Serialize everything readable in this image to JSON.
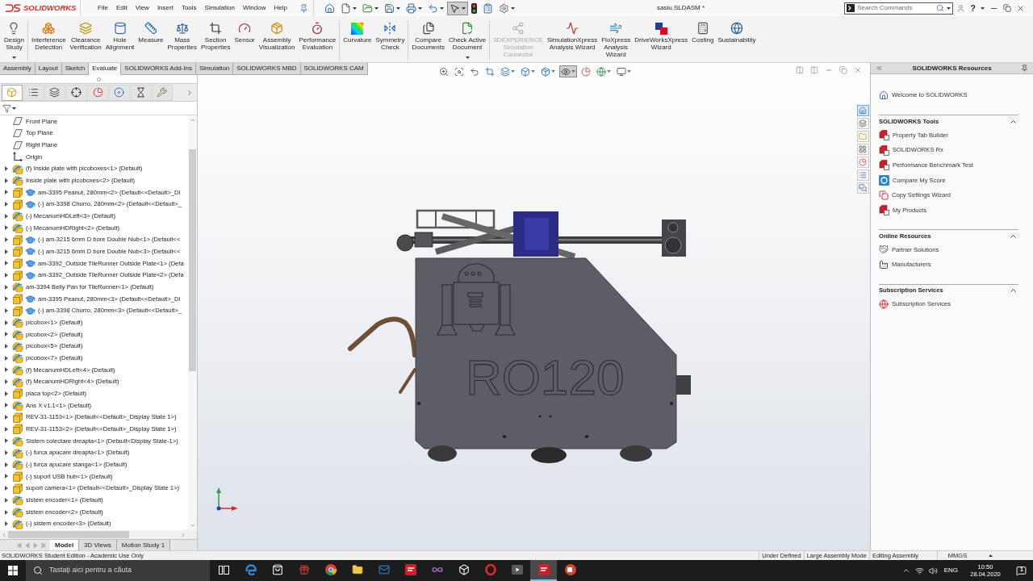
{
  "app": {
    "logo_text": "SOLIDWORKS",
    "title": "sasiu.SLDASM *",
    "search_placeholder": "Search Commands",
    "help": "?"
  },
  "menu": [
    "File",
    "Edit",
    "View",
    "Insert",
    "Tools",
    "Simulation",
    "Window",
    "Help"
  ],
  "quick_access": [
    {
      "kind": "home",
      "dropdown": false,
      "pressed": false
    },
    {
      "kind": "new",
      "dropdown": true,
      "pressed": false
    },
    {
      "kind": "open",
      "dropdown": true,
      "pressed": false
    },
    {
      "kind": "save",
      "dropdown": true,
      "pressed": false
    },
    {
      "kind": "print",
      "dropdown": true,
      "pressed": false
    },
    {
      "kind": "undo",
      "dropdown": true,
      "pressed": false
    },
    {
      "kind": "select",
      "dropdown": true,
      "pressed": true
    },
    {
      "kind": "rebuild",
      "dropdown": false,
      "pressed": false
    },
    {
      "kind": "file-properties",
      "dropdown": false,
      "pressed": false
    },
    {
      "kind": "options",
      "dropdown": true,
      "pressed": false
    }
  ],
  "ribbon": {
    "groups": [
      {
        "buttons": [
          {
            "kind": "design-study",
            "label": [
              "Design",
              "Study"
            ],
            "dropdown": true,
            "disabled": false
          }
        ]
      },
      {
        "buttons": [
          {
            "kind": "interference",
            "label": [
              "Interference",
              "Detection"
            ],
            "dropdown": false,
            "disabled": false
          },
          {
            "kind": "clearance",
            "label": [
              "Clearance",
              "Verification"
            ],
            "dropdown": false,
            "disabled": false
          },
          {
            "kind": "hole-alignment",
            "label": [
              "Hole",
              "Alignment"
            ],
            "dropdown": false,
            "disabled": false
          },
          {
            "kind": "measure",
            "label": [
              "Measure"
            ],
            "dropdown": false,
            "disabled": false
          },
          {
            "kind": "mass-properties",
            "label": [
              "Mass",
              "Properties"
            ],
            "dropdown": false,
            "disabled": false
          },
          {
            "kind": "section-properties",
            "label": [
              "Section",
              "Properties"
            ],
            "dropdown": false,
            "disabled": false
          },
          {
            "kind": "sensor",
            "label": [
              "Sensor"
            ],
            "dropdown": false,
            "disabled": false
          },
          {
            "kind": "assembly-visualization",
            "label": [
              "Assembly",
              "Visualization"
            ],
            "dropdown": false,
            "disabled": false
          },
          {
            "kind": "performance",
            "label": [
              "Performance",
              "Evaluation"
            ],
            "dropdown": false,
            "disabled": false
          }
        ]
      },
      {
        "buttons": [
          {
            "kind": "curvature",
            "label": [
              "Curvature"
            ],
            "dropdown": false,
            "disabled": false
          },
          {
            "kind": "symmetry",
            "label": [
              "Symmetry",
              "Check"
            ],
            "dropdown": false,
            "disabled": false
          }
        ]
      },
      {
        "buttons": [
          {
            "kind": "compare",
            "label": [
              "Compare",
              "Documents"
            ],
            "dropdown": false,
            "disabled": false
          },
          {
            "kind": "check-document",
            "label": [
              "Check Active",
              "Document"
            ],
            "dropdown": true,
            "disabled": false
          }
        ]
      },
      {
        "buttons": [
          {
            "kind": "connector",
            "label": [
              "3DEXPERIENCE",
              "Simulation",
              "Connector"
            ],
            "dropdown": false,
            "disabled": true
          },
          {
            "kind": "simulationxpress",
            "label": [
              "SimulationXpress",
              "Analysis Wizard"
            ],
            "dropdown": false,
            "disabled": false
          },
          {
            "kind": "floxpress",
            "label": [
              "FloXpress",
              "Analysis",
              "Wizard"
            ],
            "dropdown": false,
            "disabled": false
          },
          {
            "kind": "driveworks",
            "label": [
              "DriveWorksXpress",
              "Wizard"
            ],
            "dropdown": false,
            "disabled": false
          },
          {
            "kind": "costing",
            "label": [
              "Costing"
            ],
            "dropdown": false,
            "disabled": false
          },
          {
            "kind": "sustainability",
            "label": [
              "Sustainability"
            ],
            "dropdown": false,
            "disabled": false
          }
        ]
      }
    ],
    "tabs": [
      {
        "label": "Assembly",
        "selected": false
      },
      {
        "label": "Layout",
        "selected": false
      },
      {
        "label": "Sketch",
        "selected": false
      },
      {
        "label": "Evaluate",
        "selected": true
      },
      {
        "label": "SOLIDWORKS Add-Ins",
        "selected": false
      },
      {
        "label": "Simulation",
        "selected": false
      },
      {
        "label": "SOLIDWORKS MBD",
        "selected": false
      },
      {
        "label": "SOLIDWORKS CAM",
        "selected": false
      }
    ]
  },
  "viewport": {
    "heads_up": [
      {
        "kind": "zoom-fit",
        "dropdown": false,
        "pressed": false
      },
      {
        "kind": "zoom-area",
        "dropdown": false,
        "pressed": false
      },
      {
        "kind": "previous-view",
        "dropdown": false,
        "pressed": false
      },
      {
        "kind": "section-view",
        "dropdown": false,
        "pressed": false
      },
      {
        "kind": "dynamic-annotation",
        "dropdown": true,
        "pressed": false
      },
      {
        "kind": "view-orientation",
        "dropdown": true,
        "pressed": false
      },
      {
        "kind": "display-style",
        "dropdown": true,
        "pressed": false
      },
      {
        "kind": "hide-show",
        "dropdown": true,
        "pressed": true
      },
      {
        "kind": "edit-appearance",
        "dropdown": false,
        "pressed": false
      },
      {
        "kind": "apply-scene",
        "dropdown": true,
        "pressed": false
      },
      {
        "kind": "view-settings",
        "dropdown": true,
        "pressed": false
      }
    ],
    "engraving": "RO120"
  },
  "left_panel": {
    "tabs": [
      {
        "kind": "feature-manager",
        "selected": true
      },
      {
        "kind": "property-manager",
        "selected": false
      },
      {
        "kind": "configuration-manager",
        "selected": false
      },
      {
        "kind": "dimxpert",
        "selected": false
      },
      {
        "kind": "display-manager",
        "selected": false
      },
      {
        "kind": "cam-feature",
        "selected": false
      },
      {
        "kind": "cam-operation",
        "selected": false
      },
      {
        "kind": "cam-tools",
        "selected": false
      }
    ],
    "tree": [
      {
        "kind": "plane",
        "label": "Front Plane"
      },
      {
        "kind": "plane",
        "label": "Top Plane"
      },
      {
        "kind": "plane",
        "label": "Right Plane"
      },
      {
        "kind": "origin",
        "label": "Origin"
      },
      {
        "kind": "assembly",
        "label": "(f) Inside plate with picoboxes<1> (Default)",
        "expanded": false
      },
      {
        "kind": "assembly",
        "label": "Inside plate with picoboxes<2> (Default)",
        "expanded": false
      },
      {
        "kind": "toolbox-part",
        "label": "am-3395 Peanut, 280mm<2> (Default<<Default>_Di",
        "expanded": false
      },
      {
        "kind": "toolbox-part",
        "label": "(-) am-3398 Churro, 280mm<2> (Default<<Default>_",
        "expanded": false
      },
      {
        "kind": "assembly",
        "label": "(-) MecanumHDLeft<3> (Default)",
        "expanded": false
      },
      {
        "kind": "assembly",
        "label": "(-) MecanumHDRight<2> (Default)",
        "expanded": false
      },
      {
        "kind": "toolbox-part",
        "label": "(-) am-3215 6mm D bore Double Nub<1> (Default<<",
        "expanded": false
      },
      {
        "kind": "toolbox-part",
        "label": "(-) am-3215 6mm D bore Double Nub<3> (Default<<",
        "expanded": false
      },
      {
        "kind": "toolbox-part",
        "label": "am-3392_Outside TileRunner Outside Plate<1> (Defa",
        "expanded": false
      },
      {
        "kind": "toolbox-part",
        "label": "am-3392_Outside TileRunner Outside Plate<2> (Defa",
        "expanded": false
      },
      {
        "kind": "assembly",
        "label": "am-3394 Belly Pan for TileRunner<1> (Default)",
        "expanded": false
      },
      {
        "kind": "toolbox-part",
        "label": "am-3395 Peanut, 280mm<3> (Default<<Default>_Di",
        "expanded": false
      },
      {
        "kind": "toolbox-part",
        "label": "(-) am-3398 Churro, 280mm<3> (Default<<Default>_",
        "expanded": false
      },
      {
        "kind": "assembly",
        "label": "picobox<1> (Default)",
        "expanded": false
      },
      {
        "kind": "assembly",
        "label": "picobox<2> (Default)",
        "expanded": false
      },
      {
        "kind": "assembly",
        "label": "picobox<5> (Default)",
        "expanded": false
      },
      {
        "kind": "assembly",
        "label": "picobox<7> (Default)",
        "expanded": false
      },
      {
        "kind": "assembly",
        "label": "(f) MecanumHDLeft<4> (Default)",
        "expanded": false
      },
      {
        "kind": "assembly",
        "label": "(f) MecanumHDRight<4> (Default)",
        "expanded": false
      },
      {
        "kind": "part",
        "label": "placa top<2> (Default)",
        "expanded": false
      },
      {
        "kind": "assembly",
        "label": "Ans X v1.1<1> (Default)",
        "expanded": false
      },
      {
        "kind": "part",
        "label": "REV-31-1153<1> (Default<<Default>_Display State 1>)",
        "expanded": false
      },
      {
        "kind": "part",
        "label": "REV-31-1153<2> (Default<<Default>_Display State 1>)",
        "expanded": false
      },
      {
        "kind": "assembly",
        "label": "Sistem colectare dreapta<1> (Default<Display State-1>)",
        "expanded": false
      },
      {
        "kind": "assembly",
        "label": "(-) furca apucare dreapta<1> (Default)",
        "expanded": false
      },
      {
        "kind": "assembly",
        "label": "(-) furca apucare stanga<1> (Default)",
        "expanded": false
      },
      {
        "kind": "part",
        "label": "(-) suport USB hub<1> (Default)",
        "expanded": false
      },
      {
        "kind": "part",
        "label": "suport camera<1> (Default<<Default>_Display State 1>)",
        "expanded": false
      },
      {
        "kind": "assembly",
        "label": "sistem encoder<1> (Default)",
        "expanded": false
      },
      {
        "kind": "assembly",
        "label": "sistem encoder<2> (Default)",
        "expanded": false
      },
      {
        "kind": "assembly",
        "label": "(-) sistem encoder<3> (Default)",
        "expanded": false
      }
    ],
    "bottom_tabs": [
      {
        "label": "Model",
        "selected": true
      },
      {
        "label": "3D Views",
        "selected": false
      },
      {
        "label": "Motion Study 1",
        "selected": false
      }
    ]
  },
  "task_pane": [
    {
      "kind": "resources",
      "selected": true
    },
    {
      "kind": "design-library",
      "selected": false
    },
    {
      "kind": "file-explorer",
      "selected": false
    },
    {
      "kind": "view-palette",
      "selected": false
    },
    {
      "kind": "appearances",
      "selected": false
    },
    {
      "kind": "custom-properties",
      "selected": false
    },
    {
      "kind": "forum",
      "selected": false
    }
  ],
  "resources": {
    "title": "SOLIDWORKS Resources",
    "welcome": "Welcome to SOLIDWORKS",
    "sections": [
      {
        "title": "SOLIDWORKS Tools",
        "expanded": true,
        "items": [
          {
            "kind": "tab-builder",
            "label": "Property Tab Builder"
          },
          {
            "kind": "rx",
            "label": "SOLIDWORKS Rx"
          },
          {
            "kind": "benchmark",
            "label": "Performance Benchmark Test"
          },
          {
            "kind": "score",
            "label": "Compare My Score"
          },
          {
            "kind": "copy-settings",
            "label": "Copy Settings Wizard"
          },
          {
            "kind": "products",
            "label": "My Products"
          }
        ]
      },
      {
        "title": "Online Resources",
        "expanded": true,
        "items": [
          {
            "kind": "partners",
            "label": "Partner Solutions"
          },
          {
            "kind": "manufacturers",
            "label": "Manufacturers"
          }
        ]
      },
      {
        "title": "Subscription Services",
        "expanded": true,
        "items": [
          {
            "kind": "subscription",
            "label": "Subscription Services"
          }
        ]
      }
    ]
  },
  "status_bar": {
    "left": "SOLIDWORKS Student Edition - Academic Use Only",
    "right": [
      "Under Defined",
      "Large Assembly Mode",
      "Editing Assembly",
      "MMGS"
    ]
  },
  "taskbar": {
    "search_placeholder": "Tastați aici pentru a căuta",
    "apps": [
      {
        "kind": "task-view",
        "active": false
      },
      {
        "kind": "edge",
        "active": false
      },
      {
        "kind": "store",
        "active": false
      },
      {
        "kind": "gift",
        "active": false
      },
      {
        "kind": "chrome",
        "active": false
      },
      {
        "kind": "explorer",
        "active": false
      },
      {
        "kind": "mail",
        "active": false
      },
      {
        "kind": "solidworks",
        "active": false
      },
      {
        "kind": "visual-studio",
        "active": false
      },
      {
        "kind": "unity",
        "active": false
      },
      {
        "kind": "opera",
        "active": false
      },
      {
        "kind": "media",
        "active": false
      },
      {
        "kind": "solidworks",
        "active": true
      },
      {
        "kind": "powerpoint",
        "active": false
      }
    ],
    "language": "ENG",
    "time": "10:50",
    "date": "28.04.2020",
    "notifications": "1"
  }
}
